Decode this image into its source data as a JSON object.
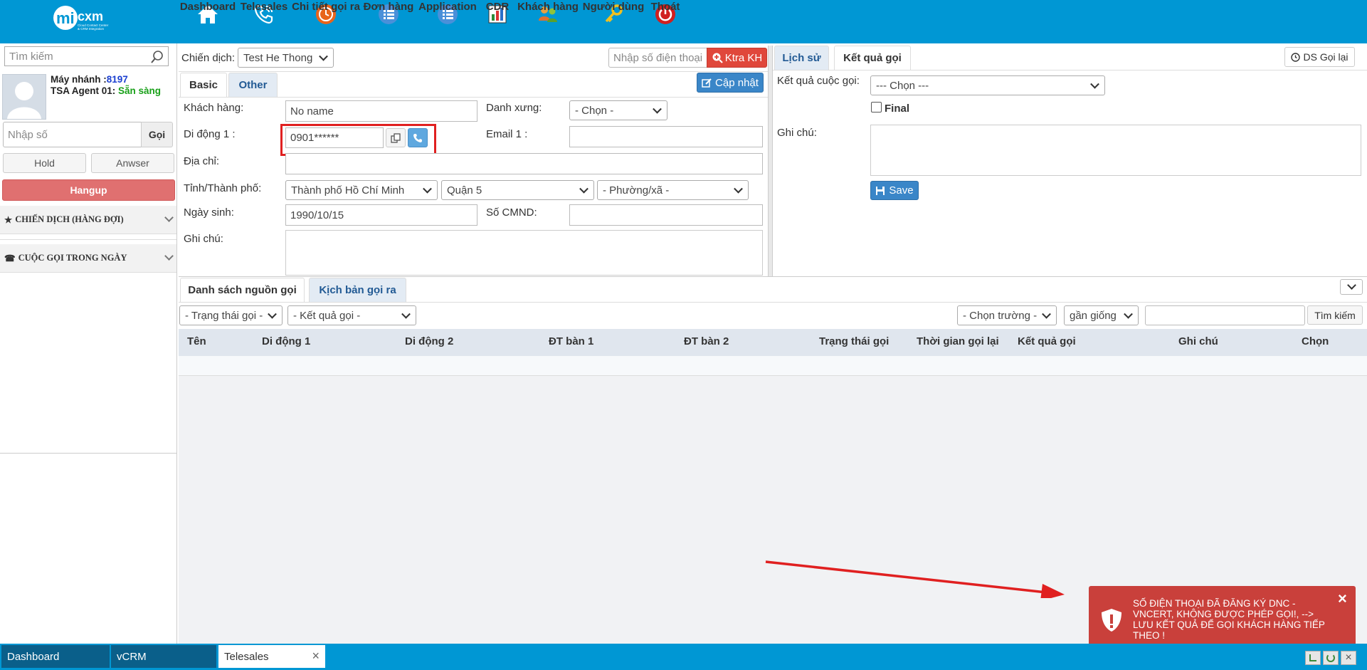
{
  "logo": {
    "text": "mi",
    "text2": "cxm",
    "tagline1": "Cloud Contact Center",
    "tagline2": "& CRM Integration"
  },
  "nav": [
    {
      "label": "Dashboard",
      "icon": "home-icon"
    },
    {
      "label": "Telesales",
      "icon": "phone-icon"
    },
    {
      "label": "Chi tiết gọi ra",
      "icon": "clock-icon"
    },
    {
      "label": "Đơn hàng",
      "icon": "list-icon"
    },
    {
      "label": "Application",
      "icon": "list-icon"
    },
    {
      "label": "CDR",
      "icon": "bar-chart-icon"
    },
    {
      "label": "Khách hàng",
      "icon": "people-icon"
    },
    {
      "label": "Người dùng",
      "icon": "key-icon"
    },
    {
      "label": "Thoát",
      "icon": "power-icon"
    }
  ],
  "sidebar": {
    "search_placeholder": "Tìm kiếm",
    "ext_label": "Máy nhánh :",
    "ext_value": "8197",
    "agent_name": "TSA Agent 01",
    "agent_status": "Sẵn sàng",
    "dial_placeholder": "Nhập số",
    "call_button": "Gọi",
    "hold_button": "Hold",
    "answer_button": "Anwser",
    "hangup_button": "Hangup",
    "section_campaign": "CHIẾN DỊCH (HÀNG ĐỢI)",
    "section_calls": "CUỘC GỌI TRONG NGÀY"
  },
  "campaign": {
    "label": "Chiến dịch:",
    "value": "Test He Thong",
    "phone_placeholder": "Nhập số điện thoại",
    "check_button": "Ktra KH"
  },
  "form": {
    "tab_basic": "Basic",
    "tab_other": "Other",
    "update_button": "Cập nhật",
    "customer_label": "Khách hàng:",
    "customer_value": "No name",
    "title_label": "Danh xưng:",
    "title_value": "- Chọn -",
    "mobile_label": "Di động 1 :",
    "mobile_value": "0901******",
    "email_label": "Email 1 :",
    "email_value": "",
    "address_label": "Địa chỉ:",
    "address_value": "",
    "province_label": "Tỉnh/Thành phố:",
    "province_value": "Thành phố Hồ Chí Minh",
    "district_value": "Quận 5",
    "ward_value": "- Phường/xã -",
    "dob_label": "Ngày sinh:",
    "dob_value": "1990/10/15",
    "id_label": "Số CMND:",
    "id_value": "",
    "note_label": "Ghi chú:"
  },
  "right": {
    "tab_history": "Lịch sử",
    "tab_result": "Kết quả gọi",
    "callback_button": "DS Gọi lại",
    "result_label": "Kết quả cuộc gọi:",
    "result_value": "--- Chọn ---",
    "final_label": "Final",
    "note_label": "Ghi chú:",
    "save_button": "Save"
  },
  "list": {
    "tab_sources": "Danh sách nguồn gọi",
    "tab_script": "Kịch bản gọi ra",
    "filter_status": "- Trạng thái gọi -",
    "filter_result": "- Kết quả gọi -",
    "filter_field": "- Chọn trường -",
    "filter_match": "gần giống",
    "search_button": "Tìm kiếm",
    "columns": [
      "Tên",
      "Di động 1",
      "Di động 2",
      "ĐT bàn 1",
      "ĐT bàn 2",
      "Trạng thái gọi",
      "Thời gian gọi lại",
      "Kết quả gọi",
      "Ghi chú",
      "Chọn"
    ]
  },
  "toast": {
    "message": "SỐ ĐIỆN THOẠI ĐÃ ĐĂNG KÝ DNC - VNCERT, KHÔNG ĐƯỢC PHÉP GỌI!, --> LƯU KẾT QUẢ ĐỂ GỌI KHÁCH HÀNG TIẾP THEO !",
    "close": "×",
    "color": "#c9403b"
  },
  "bottom_tabs": [
    {
      "label": "Dashboard"
    },
    {
      "label": "vCRM"
    },
    {
      "label": "Telesales"
    }
  ],
  "bottom_close": "×",
  "colors": {
    "topbar": "#0097d4",
    "hangup": "#e07070",
    "accent": "#3a86c8",
    "highlight": "#e02020"
  }
}
